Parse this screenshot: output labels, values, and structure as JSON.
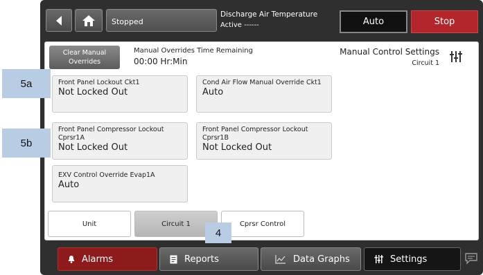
{
  "header": {
    "status": "Stopped",
    "discharge_air_title": "Discharge Air Temperature",
    "discharge_air_value": "Active ------",
    "auto_label": "Auto",
    "stop_label": "Stop"
  },
  "panel": {
    "clear_manual_overrides": "Clear Manual Overrides",
    "overrides_time_title": "Manual Overrides Time Remaining",
    "overrides_time_value": "00:00 Hr:Min",
    "settings_title": "Manual Control Settings",
    "settings_subtitle": "Circuit 1"
  },
  "cards": [
    {
      "label": "Front Panel Lockout Ckt1",
      "value": "Not Locked Out"
    },
    {
      "label": "Cond Air Flow Manual Override Ckt1",
      "value": "Auto"
    },
    {
      "label": "Front Panel Compressor Lockout Cprsr1A",
      "value": "Not Locked Out"
    },
    {
      "label": "Front Panel Compressor Lockout Cprsr1B",
      "value": "Not Locked Out"
    },
    {
      "label": "EXV Control Override Evap1A",
      "value": "Auto"
    }
  ],
  "tabs": [
    {
      "label": "Unit",
      "active": false
    },
    {
      "label": "Circuit 1",
      "active": true
    },
    {
      "label": "Cprsr Control",
      "active": false
    }
  ],
  "bottom_nav": {
    "alarms": "Alarms",
    "reports": "Reports",
    "data_graphs": "Data Graphs",
    "settings": "Settings"
  },
  "callouts": {
    "a": "5a",
    "b": "5b",
    "c": "4"
  },
  "colors": {
    "stop": "#b3262c",
    "alarms": "#8e1b1b",
    "callout": "#b8cce4"
  }
}
